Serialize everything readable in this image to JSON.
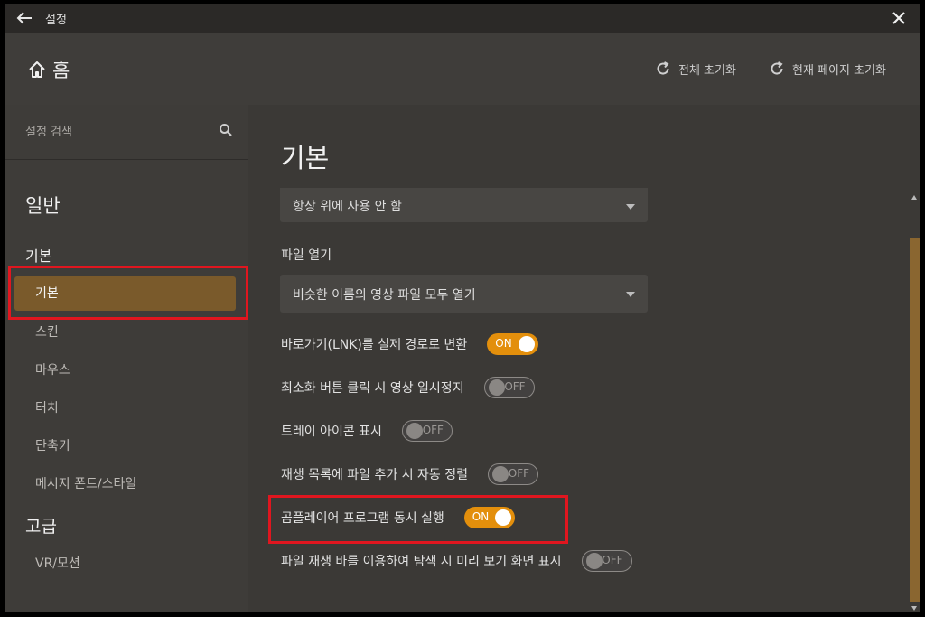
{
  "window": {
    "title": "설정"
  },
  "header": {
    "home_label": "홈",
    "reset_all_label": "전체 초기화",
    "reset_page_label": "현재 페이지 초기화"
  },
  "sidebar": {
    "search_placeholder": "설정 검색",
    "sections": [
      {
        "title": "일반"
      },
      {
        "title": "고급"
      }
    ],
    "group_basic": "기본",
    "items": [
      {
        "label": "기본",
        "active": true
      },
      {
        "label": "스킨"
      },
      {
        "label": "마우스"
      },
      {
        "label": "터치"
      },
      {
        "label": "단축키"
      },
      {
        "label": "메시지 폰트/스타일"
      },
      {
        "label": "VR/모션"
      }
    ]
  },
  "content": {
    "title": "기본",
    "dropdown1": {
      "value": "항상 위에 사용 안 함"
    },
    "file_open_label": "파일 열기",
    "dropdown2": {
      "value": "비슷한 이름의 영상 파일 모두 열기"
    },
    "toggles": [
      {
        "label": "바로가기(LNK)를 실제 경로로 변환",
        "state": "ON"
      },
      {
        "label": "최소화 버튼 클릭 시 영상 일시정지",
        "state": "OFF"
      },
      {
        "label": "트레이 아이콘 표시",
        "state": "OFF"
      },
      {
        "label": "재생 목록에 파일 추가 시 자동 정렬",
        "state": "OFF"
      },
      {
        "label": "곰플레이어 프로그램 동시 실행",
        "state": "ON"
      },
      {
        "label": "파일 재생 바를 이용하여 탐색 시 미리 보기 화면 표시",
        "state": "OFF"
      }
    ]
  },
  "colors": {
    "accent": "#e38f0c",
    "highlight": "#e0161f",
    "active_item": "#7a5a2b"
  }
}
